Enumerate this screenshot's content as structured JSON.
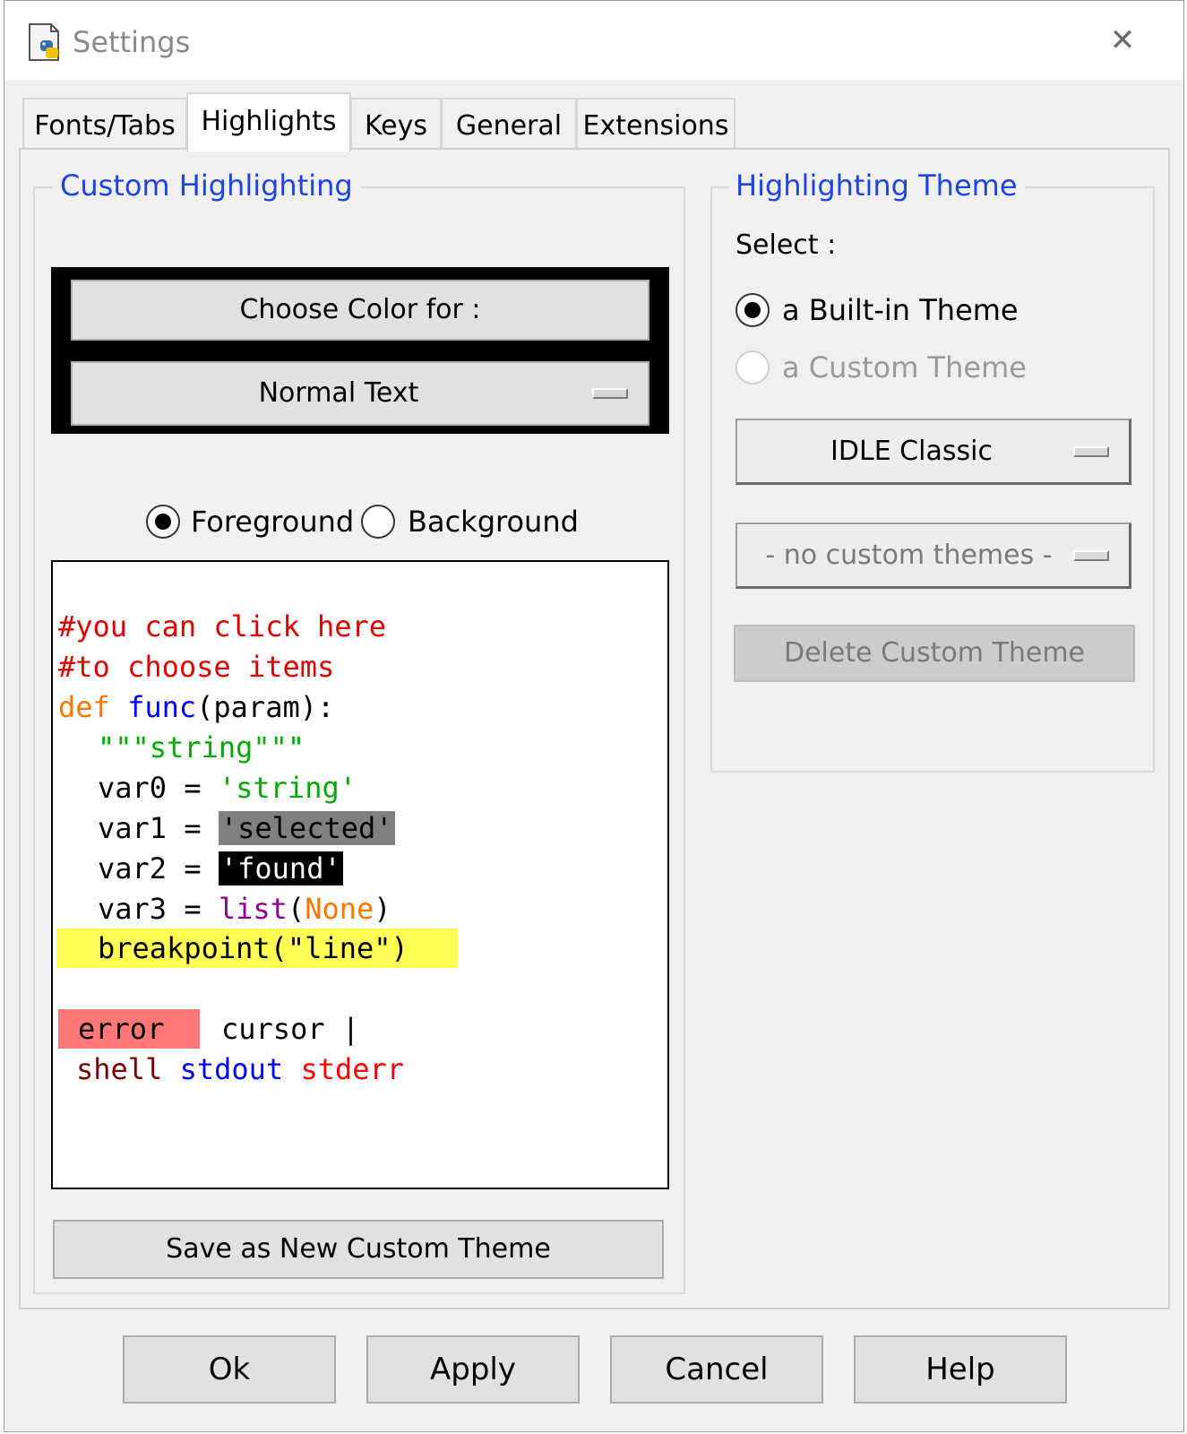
{
  "window": {
    "title": "Settings",
    "close_glyph": "✕",
    "icon": "idle-python-icon"
  },
  "tabs": [
    {
      "label": "Fonts/Tabs",
      "active": false
    },
    {
      "label": "Highlights",
      "active": true
    },
    {
      "label": "Keys",
      "active": false
    },
    {
      "label": "General",
      "active": false
    },
    {
      "label": "Extensions",
      "active": false
    }
  ],
  "custom_highlighting": {
    "legend": "Custom Highlighting",
    "choose_color_label": "Choose Color for :",
    "element_selected": "Normal Text",
    "foreground_label": "Foreground",
    "background_label": "Background",
    "foreground_selected": true,
    "save_button": "Save as New Custom Theme"
  },
  "sample": {
    "comment1": "#you can click here",
    "comment2": "#to choose items",
    "def_kw": "def",
    "func_name": "func",
    "func_rest": "(param):",
    "docstring": "\"\"\"string\"\"\"",
    "var0": "var0 = ",
    "var0_str": "'string'",
    "var1": "var1 = ",
    "var1_str": "'selected'",
    "var2": "var2 = ",
    "var2_str": "'found'",
    "var3": "var3 = ",
    "var3_builtin": "list",
    "var3_open": "(",
    "var3_none": "None",
    "var3_close": ")",
    "breakpoint": "breakpoint(\"line\")",
    "error": "error",
    "cursor": "cursor |",
    "shell": "shell",
    "stdout": "stdout",
    "stderr": "stderr"
  },
  "highlighting_theme": {
    "legend": "Highlighting Theme",
    "select_label": "Select :",
    "builtin_label": "a Built-in Theme",
    "custom_label": "a Custom Theme",
    "builtin_selected": true,
    "builtin_theme": "IDLE Classic",
    "custom_theme": "- no custom themes -",
    "delete_button": "Delete Custom Theme"
  },
  "footer": {
    "ok": "Ok",
    "apply": "Apply",
    "cancel": "Cancel",
    "help": "Help"
  },
  "colors": {
    "legend_text": "#1f44e0",
    "comment": "#dd0000",
    "keyword": "#ff7700",
    "definition": "#0000ff",
    "string": "#00aa00",
    "builtin": "#900090",
    "selected_bg": "#808080",
    "found_bg": "#000000",
    "break_bg": "#ffff55",
    "error_bg": "#ff7777",
    "stdout": "#0000ff",
    "stderr": "#ff0000",
    "shell": "#770000"
  }
}
